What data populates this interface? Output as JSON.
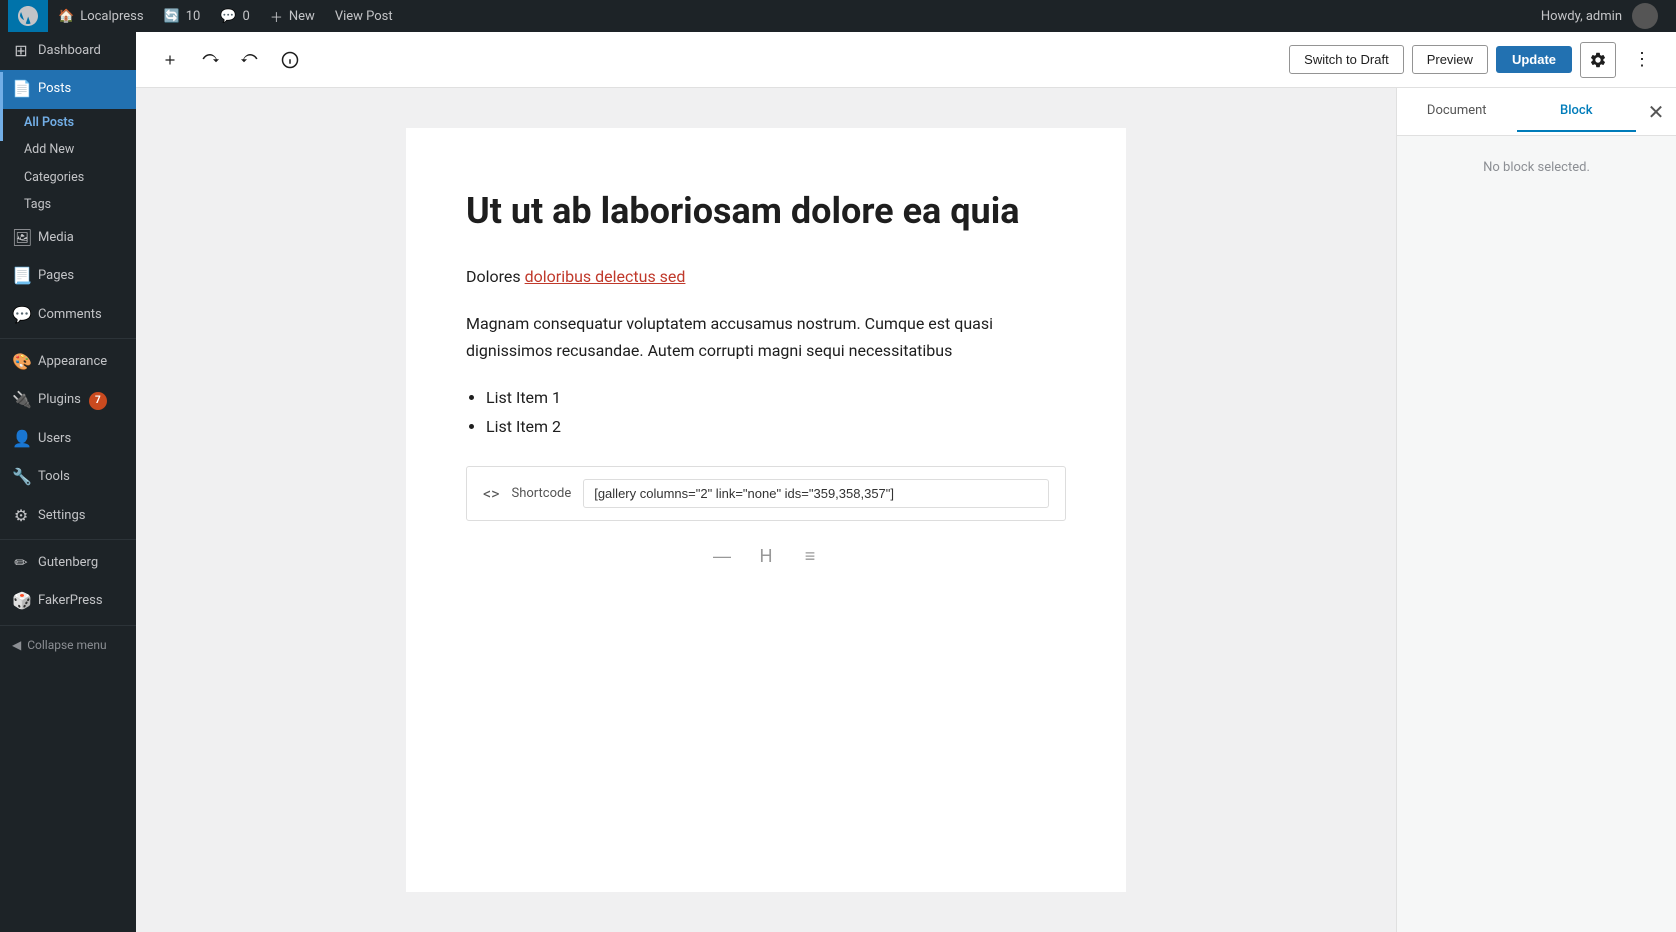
{
  "adminbar": {
    "site_name": "Localpress",
    "updates_count": "10",
    "comments_count": "0",
    "new_label": "New",
    "view_post_label": "View Post",
    "howdy": "Howdy, admin"
  },
  "sidebar": {
    "items": [
      {
        "id": "dashboard",
        "label": "Dashboard",
        "icon": "⊞"
      },
      {
        "id": "posts",
        "label": "Posts",
        "icon": "📄",
        "active": true
      },
      {
        "id": "all-posts",
        "label": "All Posts",
        "sub": true,
        "active": true
      },
      {
        "id": "add-new",
        "label": "Add New",
        "sub": true
      },
      {
        "id": "categories",
        "label": "Categories",
        "sub": true
      },
      {
        "id": "tags",
        "label": "Tags",
        "sub": true
      },
      {
        "id": "media",
        "label": "Media",
        "icon": "🖼"
      },
      {
        "id": "pages",
        "label": "Pages",
        "icon": "📃"
      },
      {
        "id": "comments",
        "label": "Comments",
        "icon": "💬"
      },
      {
        "id": "appearance",
        "label": "Appearance",
        "icon": "🎨"
      },
      {
        "id": "plugins",
        "label": "Plugins",
        "icon": "🔌",
        "badge": "7"
      },
      {
        "id": "users",
        "label": "Users",
        "icon": "👤"
      },
      {
        "id": "tools",
        "label": "Tools",
        "icon": "🔧"
      },
      {
        "id": "settings",
        "label": "Settings",
        "icon": "⚙"
      },
      {
        "id": "gutenberg",
        "label": "Gutenberg",
        "icon": "✏"
      },
      {
        "id": "fakerpress",
        "label": "FakerPress",
        "icon": "🎲"
      }
    ],
    "collapse_label": "Collapse menu"
  },
  "toolbar": {
    "add_block_title": "Add block",
    "undo_title": "Undo",
    "redo_title": "Redo",
    "info_title": "View post details",
    "switch_to_draft_label": "Switch to Draft",
    "preview_label": "Preview",
    "update_label": "Update",
    "settings_title": "Settings",
    "more_title": "More options"
  },
  "editor": {
    "post_title": "Ut ut ab laboriosam dolore ea quia",
    "paragraph1": "Dolores ",
    "paragraph1_link": "doloribus delectus sed",
    "paragraph2": "Magnam consequatur voluptatem accusamus nostrum. Cumque est quasi dignissimos recusandae. Autem corrupti magni sequi necessitatibus",
    "list_items": [
      "List Item 1",
      "List Item 2"
    ],
    "shortcode_label": "Shortcode",
    "shortcode_value": "[gallery columns=\"2\" link=\"none\" ids=\"359,358,357\"]"
  },
  "right_panel": {
    "document_tab": "Document",
    "block_tab": "Block",
    "no_block_msg": "No block selected."
  }
}
